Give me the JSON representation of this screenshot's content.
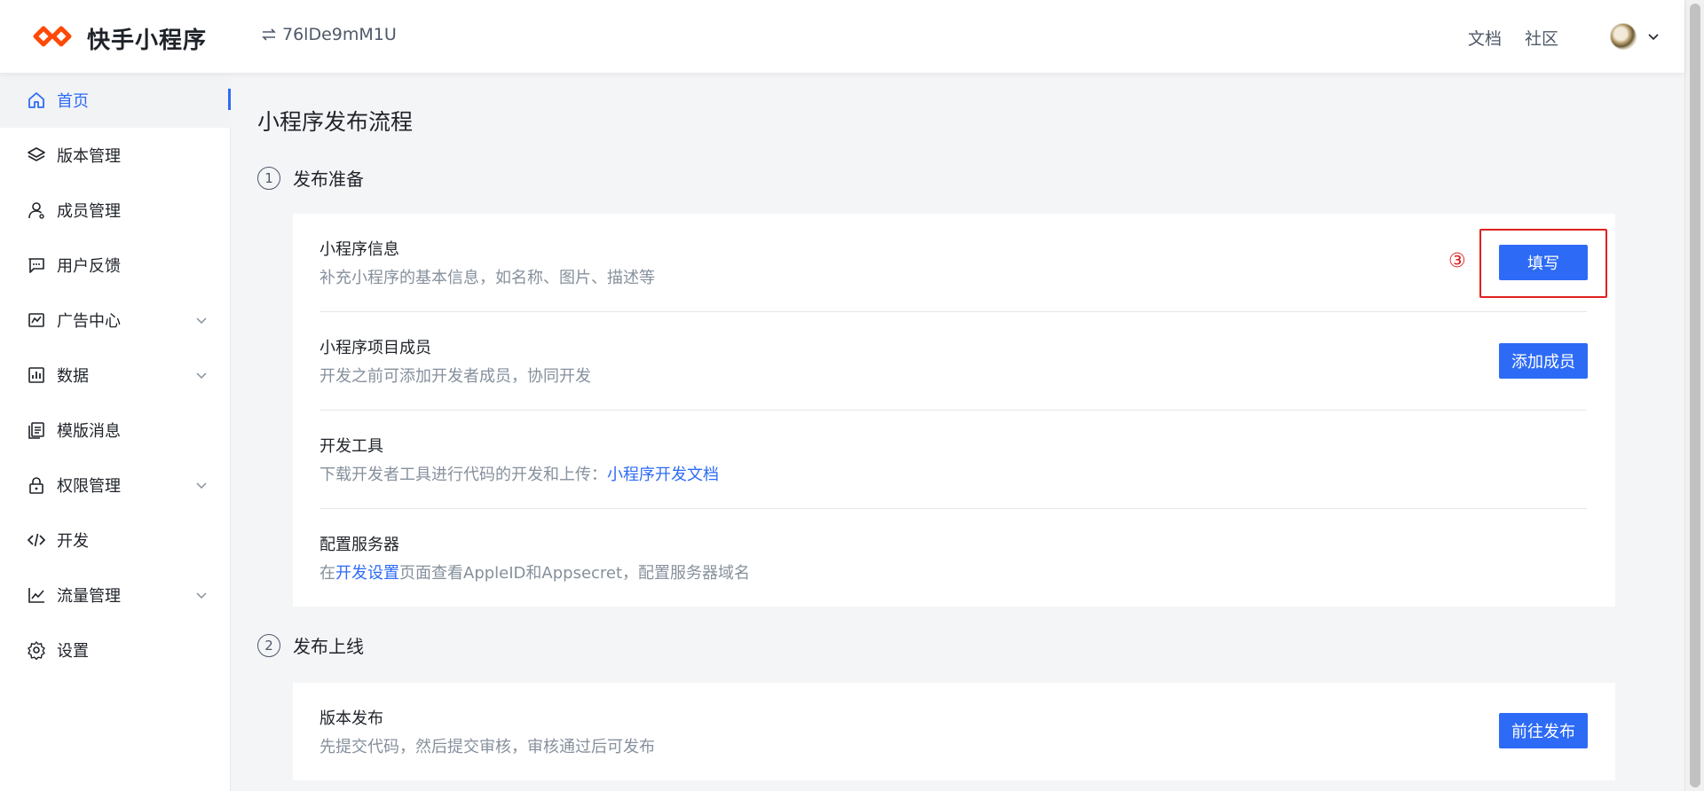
{
  "header": {
    "logo_text": "快手小程序",
    "app_id": "76lDe9mM1U",
    "nav": [
      "文档",
      "社区"
    ]
  },
  "sidebar": {
    "items": [
      {
        "label": "首页",
        "icon": "home-icon",
        "active": true,
        "expandable": false
      },
      {
        "label": "版本管理",
        "icon": "layers-icon",
        "active": false,
        "expandable": false
      },
      {
        "label": "成员管理",
        "icon": "user-icon",
        "active": false,
        "expandable": false
      },
      {
        "label": "用户反馈",
        "icon": "message-icon",
        "active": false,
        "expandable": false
      },
      {
        "label": "广告中心",
        "icon": "ad-icon",
        "active": false,
        "expandable": true
      },
      {
        "label": "数据",
        "icon": "chart-icon",
        "active": false,
        "expandable": true
      },
      {
        "label": "模版消息",
        "icon": "template-icon",
        "active": false,
        "expandable": false
      },
      {
        "label": "权限管理",
        "icon": "lock-icon",
        "active": false,
        "expandable": true
      },
      {
        "label": "开发",
        "icon": "code-icon",
        "active": false,
        "expandable": false
      },
      {
        "label": "流量管理",
        "icon": "trend-icon",
        "active": false,
        "expandable": true
      },
      {
        "label": "设置",
        "icon": "gear-icon",
        "active": false,
        "expandable": false
      }
    ]
  },
  "main": {
    "title": "小程序发布流程",
    "steps": [
      {
        "num": "1",
        "title": "发布准备"
      },
      {
        "num": "2",
        "title": "发布上线"
      }
    ],
    "prep_rows": [
      {
        "title": "小程序信息",
        "desc": "补充小程序的基本信息，如名称、图片、描述等",
        "button": "填写"
      },
      {
        "title": "小程序项目成员",
        "desc": "开发之前可添加开发者成员，协同开发",
        "button": "添加成员"
      },
      {
        "title": "开发工具",
        "desc_prefix": "下载开发者工具进行代码的开发和上传：",
        "desc_link": "小程序开发文档"
      },
      {
        "title": "配置服务器",
        "desc_prefix": "在",
        "desc_link": "开发设置",
        "desc_suffix": "页面查看AppleID和Appsecret，配置服务器域名"
      }
    ],
    "release_rows": [
      {
        "title": "版本发布",
        "desc": "先提交代码，然后提交审核，审核通过后可发布",
        "button": "前往发布"
      }
    ],
    "annotation": "③"
  },
  "colors": {
    "primary": "#2d6bf6",
    "annotation_red": "#e02020",
    "background": "#f4f5f7"
  }
}
